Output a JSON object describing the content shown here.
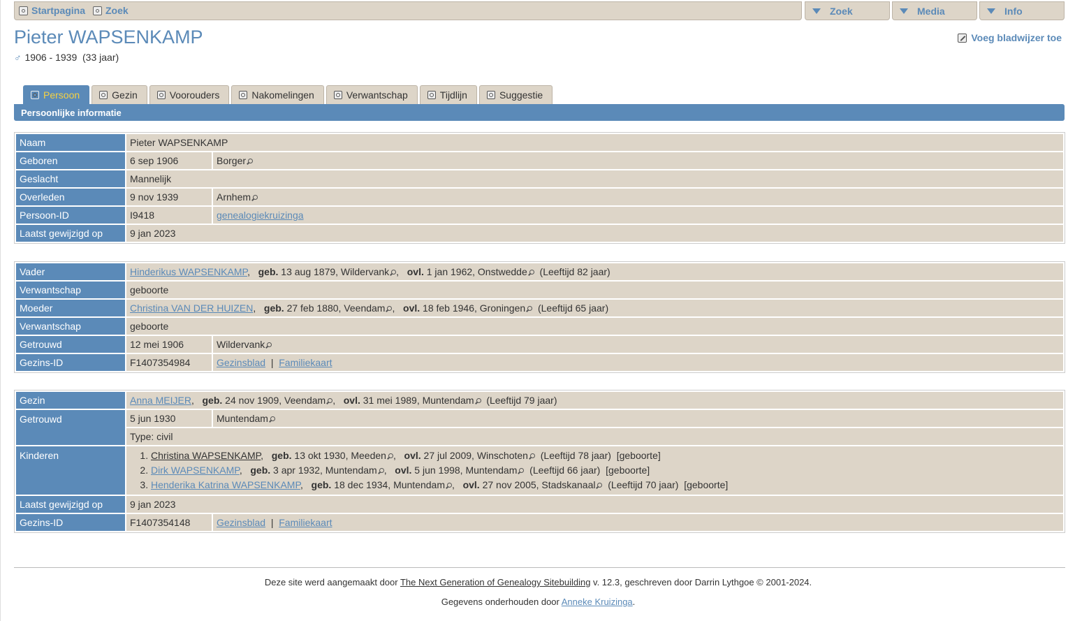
{
  "topnav": {
    "home": "Startpagina",
    "search": "Zoek"
  },
  "menus": [
    "Zoek",
    "Media",
    "Info"
  ],
  "person": {
    "name": "Pieter WAPSENKAMP",
    "sex_symbol": "♂",
    "dates": "1906 - 1939  (33 jaar)"
  },
  "bookmark": "Voeg bladwijzer toe",
  "tabs": [
    "Persoon",
    "Gezin",
    "Voorouders",
    "Nakomelingen",
    "Verwantschap",
    "Tijdlijn",
    "Suggestie"
  ],
  "section_title": "Persoonlijke informatie",
  "personal": {
    "naam_label": "Naam",
    "naam": "Pieter WAPSENKAMP",
    "geboren_label": "Geboren",
    "geboren_date": "6 sep 1906",
    "geboren_place": "Borger",
    "geslacht_label": "Geslacht",
    "geslacht": "Mannelijk",
    "overleden_label": "Overleden",
    "overleden_date": "9 nov 1939",
    "overleden_place": "Arnhem",
    "id_label": "Persoon-ID",
    "id": "I9418",
    "tree": "genealogiekruizinga",
    "changed_label": "Laatst gewijzigd op",
    "changed": "9 jan 2023"
  },
  "parents": {
    "vader_label": "Vader",
    "vader": "Hinderikus WAPSENKAMP",
    "vader_birth": "13 aug 1879, Wildervank",
    "vader_death": "1 jan 1962, Onstwedde",
    "vader_age": "(Leeftijd 82 jaar)",
    "rel_label": "Verwantschap",
    "rel": "geboorte",
    "moeder_label": "Moeder",
    "moeder": "Christina VAN DER HUIZEN",
    "moeder_birth": "27 feb 1880, Veendam",
    "moeder_death": "18 feb 1946, Groningen",
    "moeder_age": "(Leeftijd 65 jaar)",
    "married_label": "Getrouwd",
    "married_date": "12 mei 1906",
    "married_place": "Wildervank",
    "fid_label": "Gezins-ID",
    "fid": "F1407354984",
    "link1": "Gezinsblad",
    "link2": "Familiekaart"
  },
  "family": {
    "gezin_label": "Gezin",
    "spouse": "Anna MEIJER",
    "spouse_birth": "24 nov 1909, Veendam",
    "spouse_death": "31 mei 1989, Muntendam",
    "spouse_age": "(Leeftijd 79 jaar)",
    "married_label": "Getrouwd",
    "married_date": "5 jun 1930",
    "married_place": "Muntendam",
    "type": "Type: civil",
    "kids_label": "Kinderen",
    "kids": [
      {
        "name": "Christina WAPSENKAMP",
        "birth": "13 okt 1930, Meeden",
        "death": "27 jul 2009, Winschoten",
        "age": "(Leeftijd 78 jaar)",
        "rel": "[geboorte]"
      },
      {
        "name": "Dirk WAPSENKAMP",
        "birth": "3 apr 1932, Muntendam",
        "death": "5 jun 1998, Muntendam",
        "age": "(Leeftijd 66 jaar)",
        "rel": "[geboorte]"
      },
      {
        "name": "Henderika Katrina WAPSENKAMP",
        "birth": "18 dec 1934, Muntendam",
        "death": "27 nov 2005, Stadskanaal",
        "age": "(Leeftijd 70 jaar)",
        "rel": "[geboorte]"
      }
    ],
    "changed_label": "Laatst gewijzigd op",
    "changed": "9 jan 2023",
    "fid_label": "Gezins-ID",
    "fid": "F1407354148",
    "link1": "Gezinsblad",
    "link2": "Familiekaart"
  },
  "labels": {
    "geb": "geb.",
    "ovl": "ovl."
  },
  "footer": {
    "line1_pre": "Deze site werd aangemaakt door ",
    "line1_link": "The Next Generation of Genealogy Sitebuilding",
    "line1_post": " v. 12.3, geschreven door Darrin Lythgoe © 2001-2024.",
    "line2_pre": "Gegevens onderhouden door ",
    "line2_link": "Anneke Kruizinga",
    "line2_post": "."
  }
}
